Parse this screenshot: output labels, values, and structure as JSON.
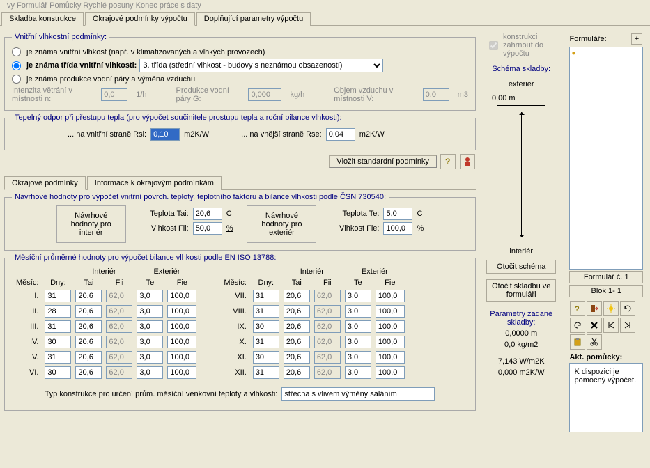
{
  "menubar": "vy    Formulář    Pomůcky    Rychlé posuny    Konec práce s daty",
  "tabs": {
    "t1": "Skladba konstrukce",
    "t2": "Okrajové podmínky výpočtu",
    "t3": "Doplňující parametry výpočtu"
  },
  "humidity": {
    "legend": "Vnitřní vlhkostní podmínky:",
    "r1": "je známa vnitřní vlhkost (např. v klimatizovaných a vlhkých provozech)",
    "r2": "je známa třída vnitřní vlhkosti:",
    "combo": "3. třída (střední vlhkost - budovy s neznámou obsazeností)",
    "r3": "je známa produkce vodní páry a výměna vzduchu",
    "vent_lbl": "Intenzita větrání v místnosti n:",
    "vent_v": "0,0",
    "vent_u": "1/h",
    "prod_lbl": "Produkce vodní páry G:",
    "prod_v": "0,000",
    "prod_u": "kg/h",
    "vol_lbl": "Objem vzduchu v místnosti V:",
    "vol_v": "0,0",
    "vol_u": "m3"
  },
  "resist": {
    "legend": "Tepelný odpor při přestupu tepla (pro výpočet součinitele prostupu tepla a roční bilance vlhkosti):",
    "in_lbl": "... na vnitřní straně Rsi:",
    "in_v": "0,10",
    "unit": "m2K/W",
    "out_lbl": "... na vnější straně Rse:",
    "out_v": "0,04"
  },
  "std_btn": "Vložit standardní podmínky",
  "subtabs": {
    "a": "Okrajové podmínky",
    "b": "Informace k okrajovým podmínkám"
  },
  "design": {
    "legend": "Návrhové hodnoty pro výpočet vnitřní povrch. teploty, teplotního faktoru a bilance vlhkosti podle ČSN 730540:",
    "box_int": "Návrhové hodnoty pro interiér",
    "box_ext": "Návrhové hodnoty pro exteriér",
    "tai_l": "Teplota Tai:",
    "tai_v": "20,6",
    "c": "C",
    "fii_l": "Vlhkost Fii:",
    "fii_v": "50,0",
    "pct": "%",
    "te_l": "Teplota Te:",
    "te_v": "5,0",
    "fie_l": "Vlhkost Fie:",
    "fie_v": "100,0"
  },
  "monthly": {
    "legend": "Měsíční průměrné hodnoty pro výpočet bilance vlhkosti podle EN ISO 13788:",
    "h_mesic": "Měsíc:",
    "h_dny": "Dny:",
    "h_int": "Interiér",
    "h_ext": "Exteriér",
    "h_tai": "Tai",
    "h_fii": "Fii",
    "h_te": "Te",
    "h_fie": "Fie",
    "left": [
      {
        "m": "I.",
        "d": "31",
        "tai": "20,6",
        "fii": "62,0",
        "te": "3,0",
        "fie": "100,0"
      },
      {
        "m": "II.",
        "d": "28",
        "tai": "20,6",
        "fii": "62,0",
        "te": "3,0",
        "fie": "100,0"
      },
      {
        "m": "III.",
        "d": "31",
        "tai": "20,6",
        "fii": "62,0",
        "te": "3,0",
        "fie": "100,0"
      },
      {
        "m": "IV.",
        "d": "30",
        "tai": "20,6",
        "fii": "62,0",
        "te": "3,0",
        "fie": "100,0"
      },
      {
        "m": "V.",
        "d": "31",
        "tai": "20,6",
        "fii": "62,0",
        "te": "3,0",
        "fie": "100,0"
      },
      {
        "m": "VI.",
        "d": "30",
        "tai": "20,6",
        "fii": "62,0",
        "te": "3,0",
        "fie": "100,0"
      }
    ],
    "right": [
      {
        "m": "VII.",
        "d": "31",
        "tai": "20,6",
        "fii": "62,0",
        "te": "3,0",
        "fie": "100,0"
      },
      {
        "m": "VIII.",
        "d": "31",
        "tai": "20,6",
        "fii": "62,0",
        "te": "3,0",
        "fie": "100,0"
      },
      {
        "m": "IX.",
        "d": "30",
        "tai": "20,6",
        "fii": "62,0",
        "te": "3,0",
        "fie": "100,0"
      },
      {
        "m": "X.",
        "d": "31",
        "tai": "20,6",
        "fii": "62,0",
        "te": "3,0",
        "fie": "100,0"
      },
      {
        "m": "XI.",
        "d": "30",
        "tai": "20,6",
        "fii": "62,0",
        "te": "3,0",
        "fie": "100,0"
      },
      {
        "m": "XII.",
        "d": "31",
        "tai": "20,6",
        "fii": "62,0",
        "te": "3,0",
        "fie": "100,0"
      }
    ],
    "constr_lbl": "Typ konstrukce pro určení prům. měsíční venkovní teploty a vlhkosti:",
    "constr_v": "střecha s vlivem výměny sáláním"
  },
  "sidebar": {
    "chk": "konstrukci zahrnout do výpočtu",
    "schema": "Schéma skladby:",
    "ext": "exteriér",
    "int": "interiér",
    "zero": "0,00 m",
    "rotate_schema": "Otočit schéma",
    "rotate_form": "Otočit skladbu ve formuláři",
    "params": "Parametry zadané skladby:",
    "p1": "0,0000 m",
    "p2": "0,0 kg/m2",
    "p3": "7,143 W/m2K",
    "p4": "0,000 m2K/W"
  },
  "right": {
    "forms": "Formuláře:",
    "plus": "+",
    "form_num": "Formulář č.  1",
    "block": "Blok  1- 1",
    "help_title": "Akt. pomůcky:",
    "help_text": "K dispozici je pomocný výpočet."
  }
}
